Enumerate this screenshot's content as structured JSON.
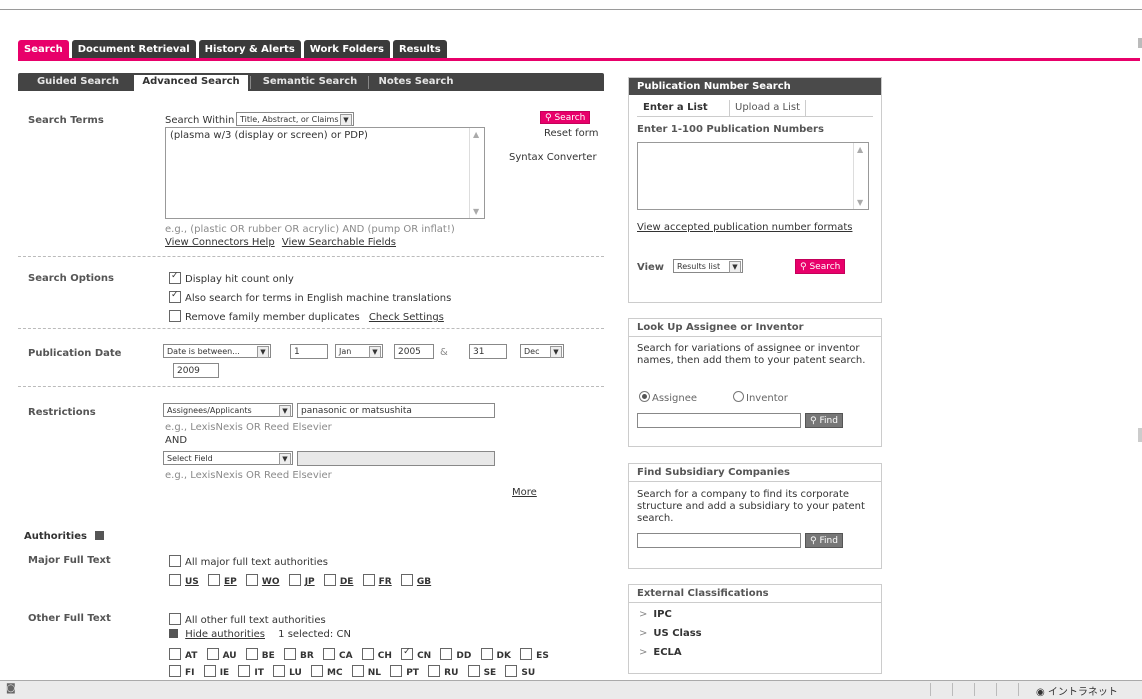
{
  "main_tabs": [
    "Search",
    "Document Retrieval",
    "History & Alerts",
    "Work Folders",
    "Results"
  ],
  "sub_tabs": [
    "Guided Search",
    "Advanced Search",
    "Semantic Search",
    "Notes Search"
  ],
  "search_terms": {
    "label": "Search Terms",
    "search_within_label": "Search Within",
    "search_within_value": "Title, Abstract, or Claims",
    "query": "(plasma w/3 (display or screen) or PDP)",
    "example": "e.g., (plastic OR rubber OR acrylic) AND (pump OR inflat!)",
    "connectors_help": "View Connectors Help",
    "searchable_fields": "View Searchable Fields",
    "search_button": "Search",
    "reset_form": "Reset form",
    "syntax_converter": "Syntax Converter"
  },
  "search_options": {
    "label": "Search Options",
    "items": [
      {
        "text": "Display hit count only",
        "checked": true
      },
      {
        "text": "Also search for terms in English machine translations",
        "checked": true
      },
      {
        "text": "Remove family member duplicates",
        "checked": false
      }
    ],
    "check_settings": "Check Settings"
  },
  "publication_date": {
    "label": "Publication Date",
    "mode": "Date is between...",
    "from_day": "1",
    "from_month": "Jan",
    "from_year": "2005",
    "amp": "&",
    "to_day": "31",
    "to_month": "Dec",
    "to_year": "2009"
  },
  "restrictions": {
    "label": "Restrictions",
    "field1": "Assignees/Applicants",
    "value1": "panasonic or matsushita",
    "example1": "e.g., LexisNexis OR Reed Elsevier",
    "and": "AND",
    "field2": "Select Field",
    "example2": "e.g., LexisNexis OR Reed Elsevier",
    "more": "More"
  },
  "authorities": {
    "title": "Authorities",
    "major_label": "Major Full Text",
    "major_all": "All major full text authorities",
    "major_codes": [
      "US",
      "EP",
      "WO",
      "JP",
      "DE",
      "FR",
      "GB"
    ],
    "other_label": "Other Full Text",
    "other_all": "All other full text authorities",
    "hide_authorities": "Hide authorities",
    "selected": "1 selected: CN",
    "other_row1": [
      "AT",
      "AU",
      "BE",
      "BR",
      "CA",
      "CH",
      "CN",
      "DD",
      "DK",
      "ES"
    ],
    "other_row2": [
      "FI",
      "IE",
      "IT",
      "LU",
      "MC",
      "NL",
      "PT",
      "RU",
      "SE",
      "SU"
    ],
    "checked_code": "CN"
  },
  "pub_number_search": {
    "title": "Publication Number Search",
    "tab_enter": "Enter a List",
    "tab_upload": "Upload a List",
    "enter_label": "Enter 1-100 Publication Numbers",
    "formats_link": "View accepted publication number formats",
    "view_label": "View",
    "view_value": "Results list",
    "search_button": "Search"
  },
  "lookup": {
    "title": "Look Up Assignee or Inventor",
    "desc": "Search for variations of assignee or inventor names, then add them to your patent search.",
    "assignee": "Assignee",
    "inventor": "Inventor",
    "find": "Find"
  },
  "subsidiary": {
    "title": "Find Subsidiary Companies",
    "desc": "Search for a company to find its corporate structure and add a subsidiary to your patent search.",
    "find": "Find"
  },
  "external": {
    "title": "External Classifications",
    "items": [
      "IPC",
      "US Class",
      "ECLA"
    ]
  },
  "status_bar": {
    "zone": "イントラネット"
  },
  "colors": {
    "accent": "#e8006a",
    "tab_dark": "#3a3a3a"
  }
}
